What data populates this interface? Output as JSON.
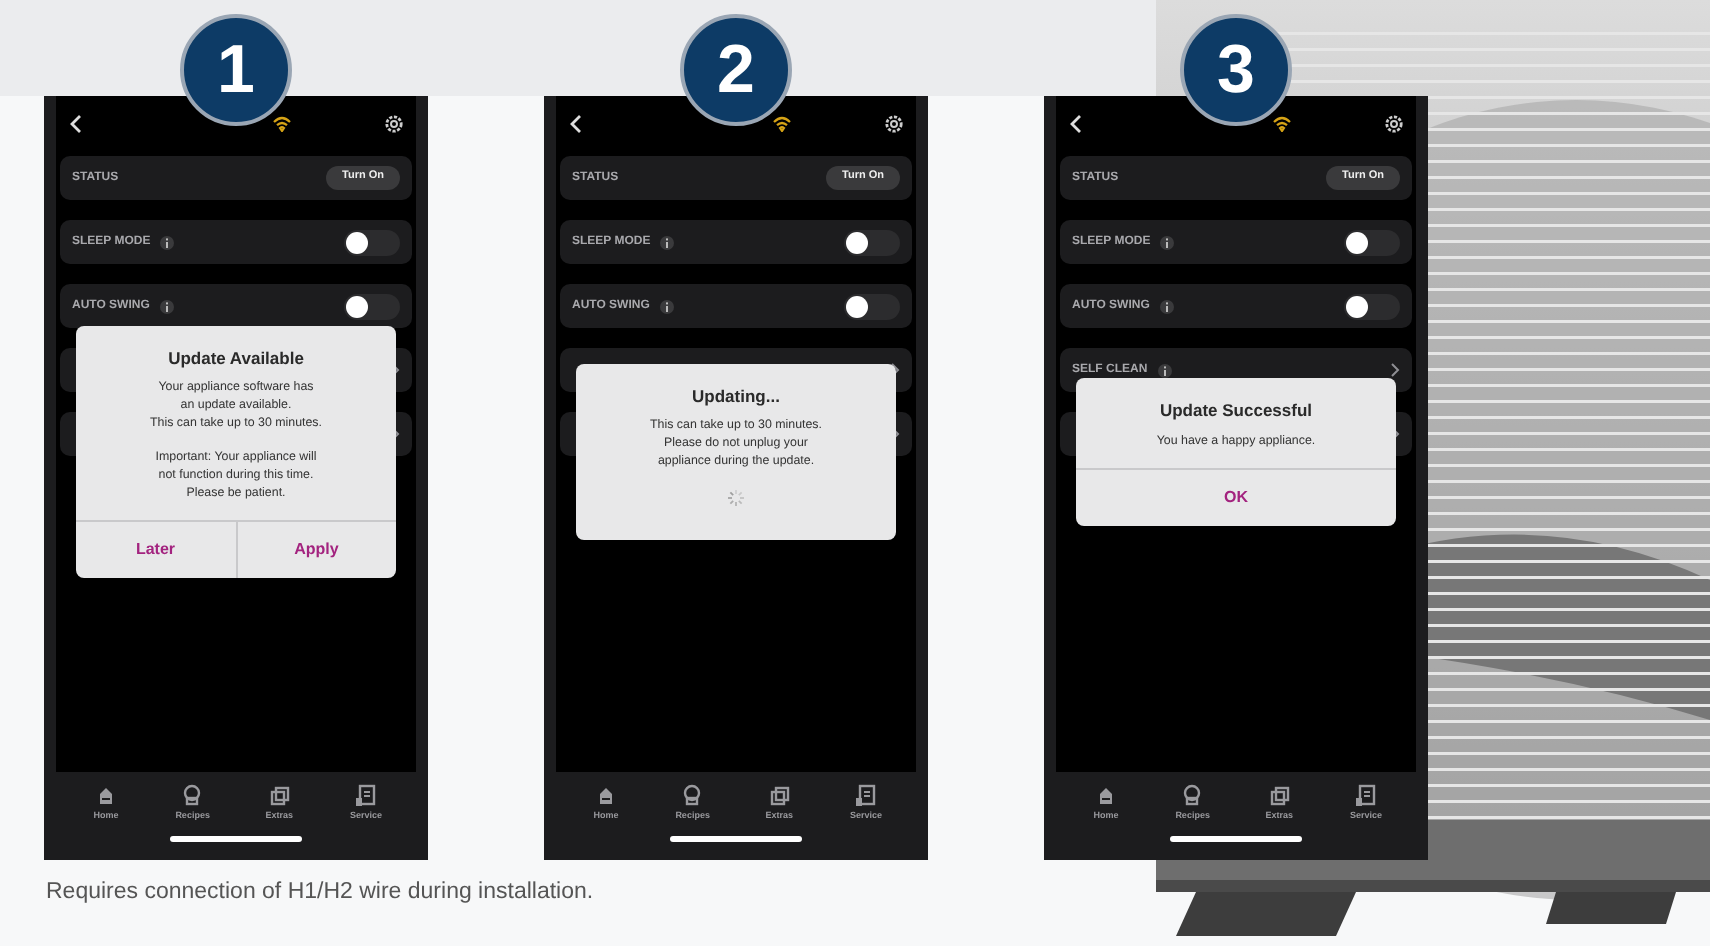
{
  "panels": [
    {
      "step": "1",
      "rows": [
        {
          "kind": "button",
          "label": "STATUS",
          "action": "Turn On"
        },
        {
          "kind": "toggle",
          "label": "SLEEP MODE",
          "info": true,
          "on": false
        },
        {
          "kind": "toggle",
          "label": "AUTO SWING",
          "info": true,
          "on": false
        },
        {
          "kind": "link"
        },
        {
          "kind": "link"
        }
      ],
      "dialog": {
        "title": "Update Available",
        "message": [
          "Your appliance software has\nan update available.\nThis can take up to 30 minutes.",
          "Important: Your appliance will\nnot function during this time.\nPlease be patient."
        ],
        "buttons": [
          "Later",
          "Apply"
        ]
      },
      "nav": [
        "Home",
        "Recipes",
        "Extras",
        "Service"
      ]
    },
    {
      "step": "2",
      "rows": [
        {
          "kind": "button",
          "label": "STATUS",
          "action": "Turn On"
        },
        {
          "kind": "toggle",
          "label": "SLEEP MODE",
          "info": true,
          "on": false
        },
        {
          "kind": "toggle",
          "label": "AUTO SWING",
          "info": true,
          "on": false
        },
        {
          "kind": "link"
        },
        {
          "kind": "link"
        }
      ],
      "dialog": {
        "title": "Updating...",
        "message": [
          "This can take up to 30 minutes.\nPlease do not unplug your\nappliance during the update."
        ],
        "spinner": true
      },
      "nav": [
        "Home",
        "Recipes",
        "Extras",
        "Service"
      ]
    },
    {
      "step": "3",
      "rows": [
        {
          "kind": "button",
          "label": "STATUS",
          "action": "Turn On"
        },
        {
          "kind": "toggle",
          "label": "SLEEP MODE",
          "info": true,
          "on": false
        },
        {
          "kind": "toggle",
          "label": "AUTO SWING",
          "info": true,
          "on": false
        },
        {
          "kind": "link",
          "label": "SELF CLEAN",
          "info": true
        },
        {
          "kind": "link"
        }
      ],
      "dialog": {
        "title": "Update Successful",
        "message": [
          "You have a happy appliance."
        ],
        "buttons": [
          "OK"
        ]
      },
      "nav": [
        "Home",
        "Recipes",
        "Extras",
        "Service"
      ]
    }
  ],
  "caption": "Requires connection of H1/H2 wire during installation."
}
